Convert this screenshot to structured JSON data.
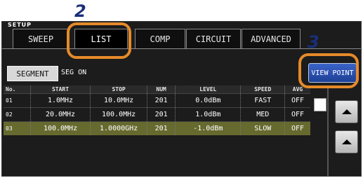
{
  "window": {
    "title": "SETUP"
  },
  "tabs": [
    {
      "label": "SWEEP"
    },
    {
      "label": "LIST"
    },
    {
      "label": "COMP"
    },
    {
      "label": "CIRCUIT"
    },
    {
      "label": "ADVANCED"
    }
  ],
  "segment": {
    "button_label": "SEGMENT",
    "status": "SEG ON"
  },
  "view_point": {
    "label": "VIEW POINT"
  },
  "table": {
    "headers": [
      "No.",
      "START",
      "STOP",
      "NUM",
      "LEVEL",
      "SPEED",
      "AVG"
    ],
    "rows": [
      [
        "01",
        "1.0MHz",
        "10.0MHz",
        "201",
        "0.0dBm",
        "FAST",
        "OFF"
      ],
      [
        "02",
        "20.0MHz",
        "100.0MHz",
        "201",
        "1.0dBm",
        "MED",
        "OFF"
      ],
      [
        "03",
        "100.0MHz",
        "1.0000GHz",
        "201",
        "-1.0dBm",
        "SLOW",
        "OFF"
      ]
    ],
    "selected_row": "03"
  },
  "icons": {
    "scroll_up": "up-arrow-icon",
    "scroll_up_2": "up-arrow-icon"
  },
  "annotations": {
    "step_list": "2",
    "step_view_point": "3"
  },
  "colors": {
    "highlight": "#e58a2a",
    "step_number": "#1a2f7a",
    "selected_row": "#666a2f",
    "view_point_button": "#2a52b5"
  }
}
